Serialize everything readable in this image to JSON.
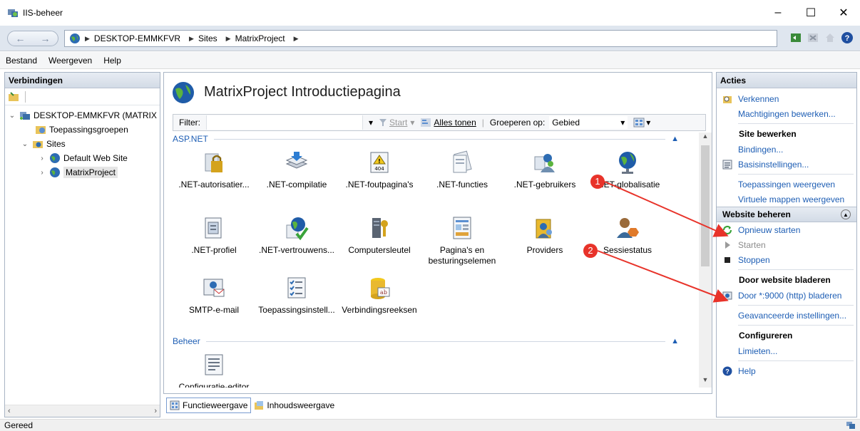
{
  "window": {
    "title": "IIS-beheer",
    "controls": [
      "–",
      "☐",
      "✕"
    ]
  },
  "address": {
    "crumbs": [
      "DESKTOP-EMMKFVR",
      "Sites",
      "MatrixProject"
    ]
  },
  "menu": {
    "items": [
      "Bestand",
      "Weergeven",
      "Help"
    ]
  },
  "connections": {
    "header": "Verbindingen",
    "tree": [
      {
        "label": "DESKTOP-EMMKFVR (MATRIX",
        "level": 0
      },
      {
        "label": "Toepassingsgroepen",
        "level": 1
      },
      {
        "label": "Sites",
        "level": 1
      },
      {
        "label": "Default Web Site",
        "level": 2
      },
      {
        "label": "MatrixProject",
        "level": 2,
        "selected": true
      }
    ]
  },
  "center": {
    "title": "MatrixProject Introductiepagina",
    "filter_label": "Filter:",
    "start_label": "Start",
    "show_all_label": "Alles tonen",
    "group_by_label": "Groeperen op:",
    "group_by_value": "Gebied",
    "groups": [
      {
        "name": "ASP.NET",
        "features": [
          ".NET-autorisatier...",
          ".NET-compilatie",
          ".NET-foutpagina's",
          ".NET-functies",
          ".NET-gebruikers",
          ".NET-globalisatie",
          ".NET-profiel",
          ".NET-vertrouwens...",
          "Computersleutel",
          "Pagina's en besturingselemen",
          "Providers",
          "Sessiestatus",
          "SMTP-e-mail",
          "Toepassingsinstell...",
          "Verbindingsreeksen"
        ]
      },
      {
        "name": "Beheer",
        "features": [
          "Configuratie-editor"
        ]
      }
    ],
    "tabs": [
      "Functieweergave",
      "Inhoudsweergave"
    ]
  },
  "actions": {
    "header": "Acties",
    "explore": "Verkennen",
    "edit_permissions": "Machtigingen bewerken...",
    "site_edit_header": "Site bewerken",
    "bindings": "Bindingen...",
    "basic_settings": "Basisinstellingen...",
    "view_apps": "Toepassingen weergeven",
    "view_vdirs": "Virtuele mappen weergeven",
    "manage_header": "Website beheren",
    "restart": "Opnieuw starten",
    "start": "Starten",
    "stop": "Stoppen",
    "browse_header": "Door website bladeren",
    "browse_link": "Door *:9000 (http) bladeren",
    "advanced": "Geavanceerde instellingen...",
    "configure_header": "Configureren",
    "limits": "Limieten...",
    "help": "Help"
  },
  "annotations": {
    "badge1": "1",
    "badge2": "2",
    "color": "#e8332a"
  },
  "status": {
    "text": "Gereed"
  }
}
